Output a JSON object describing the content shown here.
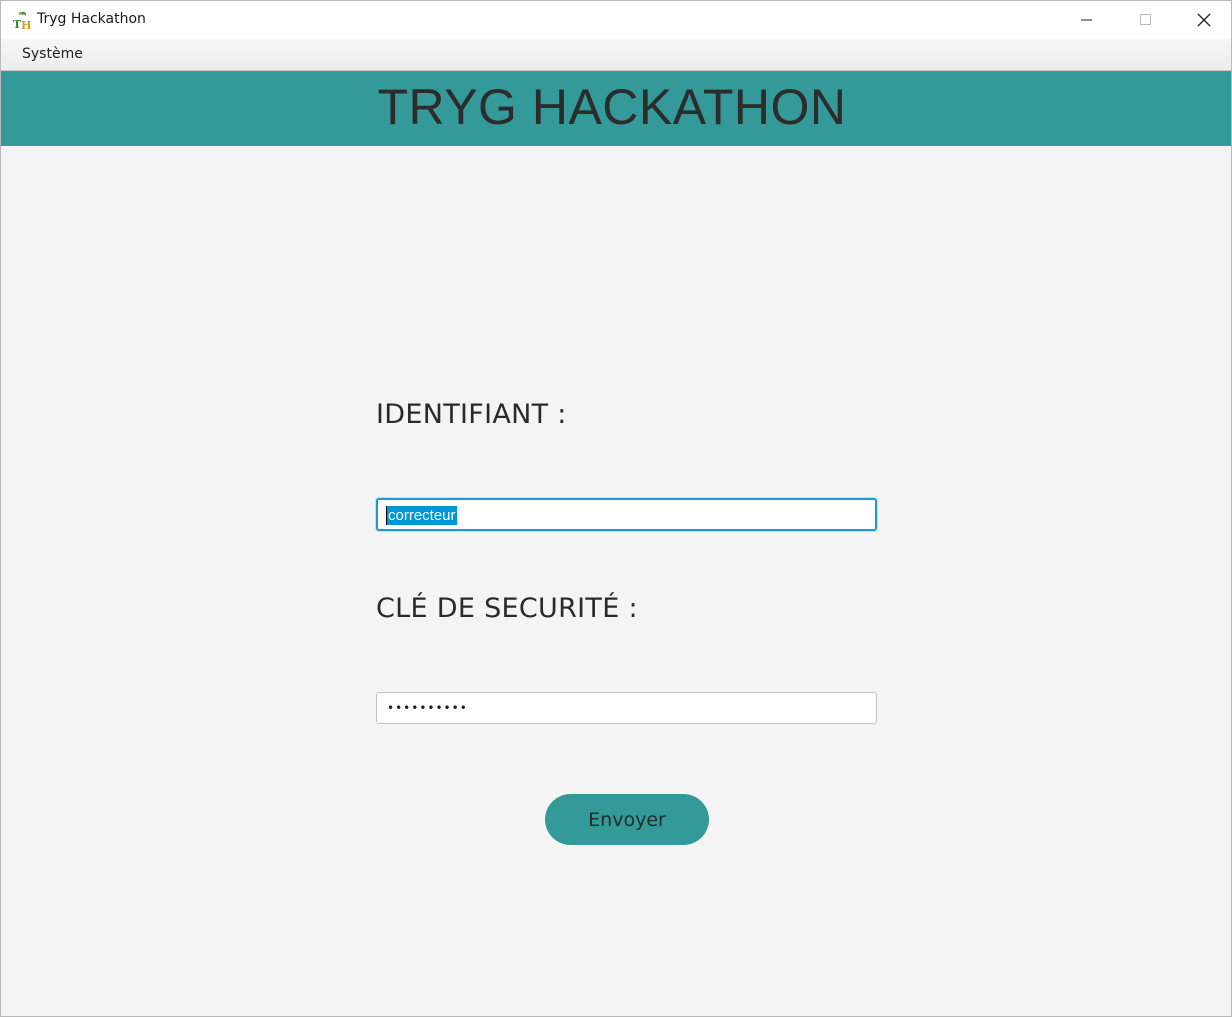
{
  "window": {
    "title": "Tryg Hackathon",
    "icon": "th-app-icon"
  },
  "menubar": {
    "items": [
      {
        "label": "Système"
      }
    ]
  },
  "banner": {
    "title": "TRYG HACKATHON",
    "color": "#339999"
  },
  "form": {
    "identifier_label": "IDENTIFIANT :",
    "identifier_value": "correcteur",
    "key_label": "CLÉ DE SECURITÉ :",
    "key_value_masked": "••••••••••",
    "submit_label": "Envoyer"
  },
  "colors": {
    "accent": "#339999",
    "selection": "#0097d4",
    "focus_border": "#1e9bd7",
    "background": "#f4f4f4"
  }
}
